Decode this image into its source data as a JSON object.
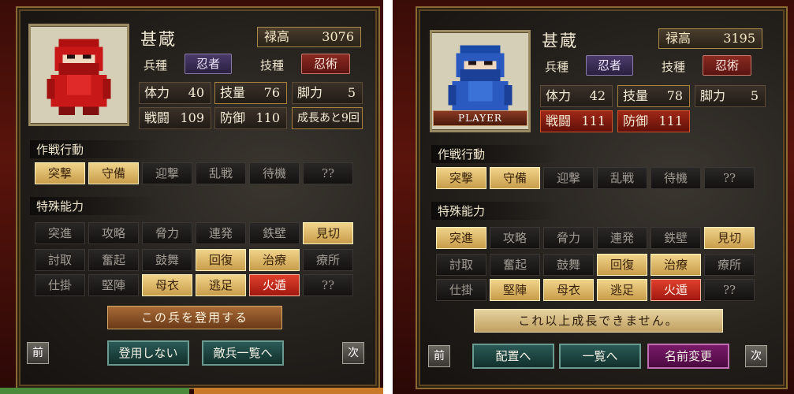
{
  "left": {
    "name": "甚蔵",
    "stipend_label": "禄高",
    "stipend_value": "3076",
    "type_label": "兵種",
    "type_value": "忍者",
    "skill_label": "技種",
    "skill_value": "忍術",
    "stats": {
      "hp": {
        "label": "体力",
        "value": "40"
      },
      "skill": {
        "label": "技量",
        "value": "76"
      },
      "legs": {
        "label": "脚力",
        "value": "5"
      },
      "battle": {
        "label": "戦闘",
        "value": "109"
      },
      "defense": {
        "label": "防御",
        "value": "110"
      },
      "growth": {
        "label": "成長あと9回"
      }
    },
    "tactics_title": "作戦行動",
    "tactics": [
      "突撃",
      "守備",
      "迎撃",
      "乱戦",
      "待機",
      "??"
    ],
    "special_title": "特殊能力",
    "special_row1": [
      "突進",
      "攻略",
      "脅力",
      "連発",
      "鉄壁",
      "見切"
    ],
    "special_row2": [
      "討取",
      "奮起",
      "鼓舞",
      "回復",
      "治療",
      "療所"
    ],
    "special_row3": [
      "仕掛",
      "堅陣",
      "母衣",
      "逃足",
      "火遁",
      "??"
    ],
    "hire_button": "この兵を登用する",
    "prev": "前",
    "next": "次",
    "no_hire": "登用しない",
    "enemy_list": "敵兵一覧へ"
  },
  "right": {
    "name": "甚蔵",
    "player_tag": "PLAYER",
    "stipend_label": "禄高",
    "stipend_value": "3195",
    "type_label": "兵種",
    "type_value": "忍者",
    "skill_label": "技種",
    "skill_value": "忍術",
    "stats": {
      "hp": {
        "label": "体力",
        "value": "42"
      },
      "skill": {
        "label": "技量",
        "value": "78"
      },
      "legs": {
        "label": "脚力",
        "value": "5"
      },
      "battle": {
        "label": "戦闘",
        "value": "111"
      },
      "defense": {
        "label": "防御",
        "value": "111"
      }
    },
    "tactics_title": "作戦行動",
    "tactics": [
      "突撃",
      "守備",
      "迎撃",
      "乱戦",
      "待機",
      "??"
    ],
    "special_title": "特殊能力",
    "special_row1": [
      "突進",
      "攻略",
      "脅力",
      "連発",
      "鉄壁",
      "見切"
    ],
    "special_row2": [
      "討取",
      "奮起",
      "鼓舞",
      "回復",
      "治療",
      "療所"
    ],
    "special_row3": [
      "仕掛",
      "堅陣",
      "母衣",
      "逃足",
      "火遁",
      "??"
    ],
    "max_growth": "これ以上成長できません。",
    "prev": "前",
    "next": "次",
    "deploy": "配置へ",
    "list": "一覧へ",
    "rename": "名前変更"
  },
  "colors": {
    "gold_button": "#e0bc6a",
    "fire_button": "#c82818",
    "ninja_red": "#c81818",
    "ninja_blue": "#2a5ac0"
  }
}
